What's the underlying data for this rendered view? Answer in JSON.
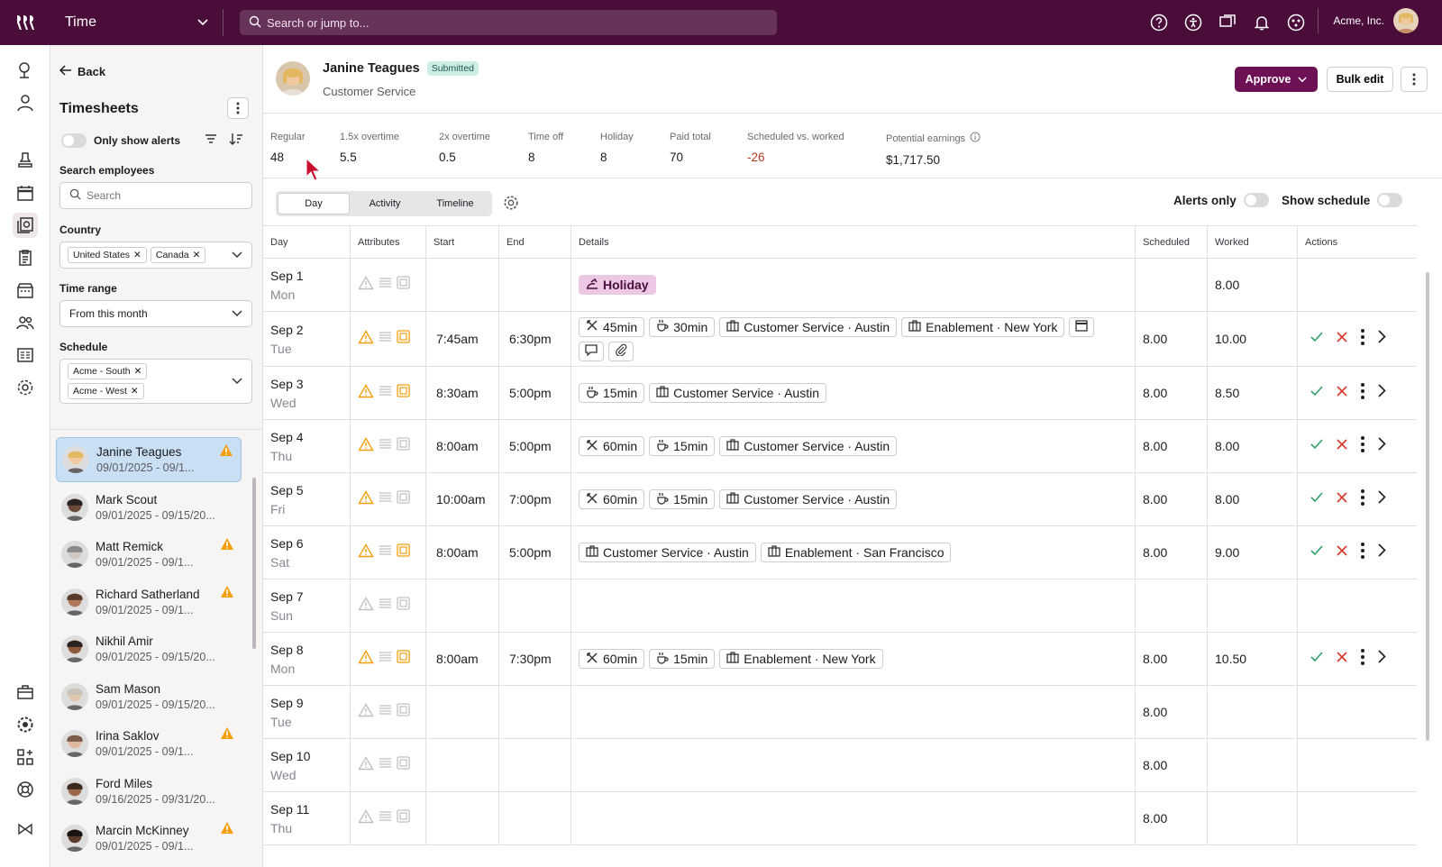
{
  "topbar": {
    "app_name": "Time",
    "search_placeholder": "Search or jump to...",
    "company": "Acme, Inc."
  },
  "left_panel": {
    "back_label": "Back",
    "title": "Timesheets",
    "alerts_toggle_label": "Only show alerts",
    "search_label": "Search employees",
    "search_placeholder": "Search",
    "country_label": "Country",
    "countries": [
      "United States",
      "Canada"
    ],
    "time_range_label": "Time range",
    "time_range_value": "From this month",
    "schedule_label": "Schedule",
    "schedules": [
      "Acme - South",
      "Acme - West"
    ],
    "employees": [
      {
        "name": "Janine Teagues",
        "dates": "09/01/2025 - 09/1...",
        "alert": true,
        "selected": true
      },
      {
        "name": "Mark Scout",
        "dates": "09/01/2025 - 09/15/20...",
        "alert": false
      },
      {
        "name": "Matt Remick",
        "dates": "09/01/2025 - 09/1...",
        "alert": true
      },
      {
        "name": "Richard Satherland",
        "dates": "09/01/2025 - 09/1...",
        "alert": true
      },
      {
        "name": "Nikhil Amir",
        "dates": "09/01/2025 - 09/15/20...",
        "alert": false
      },
      {
        "name": "Sam Mason",
        "dates": "09/01/2025 - 09/15/20...",
        "alert": false
      },
      {
        "name": "Irina Saklov",
        "dates": "09/01/2025 - 09/1...",
        "alert": true
      },
      {
        "name": "Ford Miles",
        "dates": "09/16/2025 - 09/31/20...",
        "alert": false
      },
      {
        "name": "Marcin McKinney",
        "dates": "09/01/2025 - 09/1...",
        "alert": true
      }
    ]
  },
  "header": {
    "employee_name": "Janine Teagues",
    "status": "Submitted",
    "department": "Customer Service",
    "approve_label": "Approve",
    "bulk_edit_label": "Bulk edit"
  },
  "summary": [
    {
      "label": "Regular",
      "value": "48"
    },
    {
      "label": "1.5x overtime",
      "value": "5.5"
    },
    {
      "label": "2x overtime",
      "value": "0.5"
    },
    {
      "label": "Time off",
      "value": "8"
    },
    {
      "label": "Holiday",
      "value": "8"
    },
    {
      "label": "Paid total",
      "value": "70"
    },
    {
      "label": "Scheduled vs. worked",
      "value": "-26"
    },
    {
      "label": "Potential earnings",
      "value": "$1,717.50"
    }
  ],
  "view_tabs": [
    "Day",
    "Activity",
    "Timeline"
  ],
  "toggles": {
    "alerts_only": "Alerts only",
    "show_schedule": "Show schedule"
  },
  "columns": [
    "Day",
    "Attributes",
    "Start",
    "End",
    "Details",
    "Scheduled",
    "Worked",
    "Actions"
  ],
  "rows": [
    {
      "date": "Sep 1",
      "weekday": "Mon",
      "start": "",
      "end": "",
      "scheduled": "",
      "worked": "8.00",
      "holiday": "Holiday",
      "details": [],
      "actions": false
    },
    {
      "date": "Sep 2",
      "weekday": "Tue",
      "start": "7:45am",
      "end": "6:30pm",
      "scheduled": "8.00",
      "worked": "10.00",
      "details": [
        "45min",
        "30min",
        "Customer Service · Austin",
        "Enablement · New York"
      ],
      "actions": true
    },
    {
      "date": "Sep 3",
      "weekday": "Wed",
      "start": "8:30am",
      "end": "5:00pm",
      "scheduled": "8.00",
      "worked": "8.50",
      "details": [
        "15min",
        "Customer Service · Austin"
      ],
      "actions": true
    },
    {
      "date": "Sep 4",
      "weekday": "Thu",
      "start": "8:00am",
      "end": "5:00pm",
      "scheduled": "8.00",
      "worked": "8.00",
      "details": [
        "60min",
        "15min",
        "Customer Service · Austin"
      ],
      "actions": true
    },
    {
      "date": "Sep 5",
      "weekday": "Fri",
      "start": "10:00am",
      "end": "7:00pm",
      "scheduled": "8.00",
      "worked": "8.00",
      "details": [
        "60min",
        "15min",
        "Customer Service · Austin"
      ],
      "actions": true
    },
    {
      "date": "Sep 6",
      "weekday": "Sat",
      "start": "8:00am",
      "end": "5:00pm",
      "scheduled": "8.00",
      "worked": "9.00",
      "details": [
        "Customer Service · Austin",
        "Enablement · San Francisco"
      ],
      "actions": true
    },
    {
      "date": "Sep 7",
      "weekday": "Sun",
      "start": "",
      "end": "",
      "scheduled": "",
      "worked": "",
      "details": [],
      "actions": false
    },
    {
      "date": "Sep 8",
      "weekday": "Mon",
      "start": "8:00am",
      "end": "7:30pm",
      "scheduled": "8.00",
      "worked": "10.50",
      "details": [
        "60min",
        "15min",
        "Enablement · New York"
      ],
      "actions": true
    },
    {
      "date": "Sep 9",
      "weekday": "Tue",
      "start": "",
      "end": "",
      "scheduled": "8.00",
      "worked": "",
      "details": [],
      "actions": false
    },
    {
      "date": "Sep 10",
      "weekday": "Wed",
      "start": "",
      "end": "",
      "scheduled": "8.00",
      "worked": "",
      "details": [],
      "actions": false
    },
    {
      "date": "Sep 11",
      "weekday": "Thu",
      "start": "",
      "end": "",
      "scheduled": "8.00",
      "worked": "",
      "details": [],
      "actions": false
    }
  ],
  "colors": {
    "brand": "#4a0d3a",
    "approve": "#6e1055",
    "warning": "#f59e0b",
    "approve_check": "#2f9e6b",
    "reject_x": "#d9372b",
    "negative": "#b63a22"
  }
}
